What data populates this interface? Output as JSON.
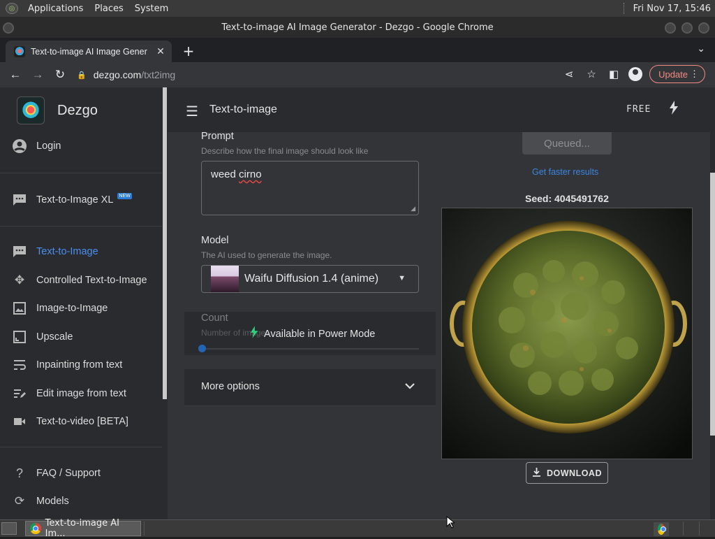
{
  "os": {
    "menus": [
      "Applications",
      "Places",
      "System"
    ],
    "clock": "Fri Nov 17, 15:46"
  },
  "window": {
    "title": "Text-to-image AI Image Generator - Dezgo - Google Chrome"
  },
  "browser": {
    "tab_title": "Text-to-image AI Image Gener",
    "url_host": "dezgo.com",
    "url_path": "/txt2img",
    "update_label": "Update"
  },
  "sidebar": {
    "brand": "Dezgo",
    "login": "Login",
    "xl_item": "Text-to-Image XL",
    "new_badge": "NEW",
    "items": [
      {
        "label": "Text-to-Image",
        "icon": "chat-icon",
        "active": true
      },
      {
        "label": "Controlled Text-to-Image",
        "icon": "move-icon"
      },
      {
        "label": "Image-to-Image",
        "icon": "image-icon"
      },
      {
        "label": "Upscale",
        "icon": "upscale-icon"
      },
      {
        "label": "Inpainting from text",
        "icon": "wrap-text-icon"
      },
      {
        "label": "Edit image from text",
        "icon": "edit-note-icon"
      },
      {
        "label": "Text-to-video [BETA]",
        "icon": "videocam-icon"
      }
    ],
    "faq": "FAQ / Support",
    "models": "Models"
  },
  "appbar": {
    "title": "Text-to-image",
    "plan": "FREE"
  },
  "form": {
    "prompt_label": "Prompt",
    "prompt_hint": "Describe how the final image should look like",
    "prompt_value": "weed cirno",
    "model_label": "Model",
    "model_hint": "The AI used to generate the image.",
    "model_value": "Waifu Diffusion 1.4 (anime)",
    "count_label": "Count",
    "count_hint": "Number of images",
    "count_overlay": "Available in Power Mode",
    "more_options": "More options"
  },
  "result": {
    "status_button": "Queued...",
    "faster_link": "Get faster results",
    "seed": "Seed: 4045491762",
    "download": "DOWNLOAD"
  },
  "taskbar": {
    "task_title": "Text-to-image AI Im..."
  }
}
